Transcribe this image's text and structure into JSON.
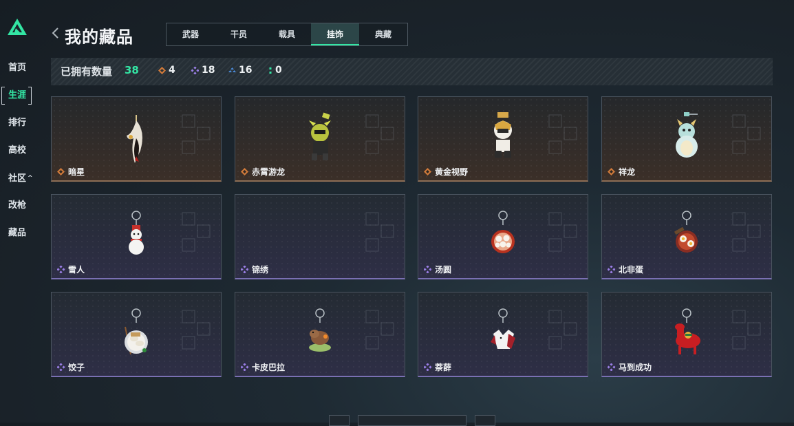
{
  "header": {
    "title": "我的藏品"
  },
  "sidebar": {
    "items": [
      {
        "label": "首页",
        "active": false
      },
      {
        "label": "生涯",
        "active": true
      },
      {
        "label": "排行",
        "active": false
      },
      {
        "label": "高校",
        "active": false
      },
      {
        "label": "社区",
        "active": false,
        "has_caret": true
      },
      {
        "label": "改枪",
        "active": false
      },
      {
        "label": "藏品",
        "active": false
      }
    ],
    "caret": "^"
  },
  "tabs": [
    {
      "label": "武器"
    },
    {
      "label": "干员"
    },
    {
      "label": "载具"
    },
    {
      "label": "挂饰",
      "active": true
    },
    {
      "label": "典藏"
    }
  ],
  "stats": {
    "owned_label": "已拥有数量",
    "owned_count": "38",
    "orange_count": "4",
    "purple_count": "18",
    "blue_count": "16",
    "green_count": "0"
  },
  "colors": {
    "accent": "#33e6a4",
    "orange_rarity": "#d07a3a",
    "purple_rarity": "#9b7fe6",
    "blue_rarity": "#4d8fe0"
  },
  "items": [
    {
      "name": "暗星",
      "rarity": "orange",
      "icon": "dark-star-charm-icon"
    },
    {
      "name": "赤霄游龙",
      "rarity": "orange",
      "icon": "red-dragon-charm-icon"
    },
    {
      "name": "黄金视野",
      "rarity": "orange",
      "icon": "golden-vision-charm-icon"
    },
    {
      "name": "祥龙",
      "rarity": "orange",
      "icon": "auspicious-dragon-charm-icon"
    },
    {
      "name": "雪人",
      "rarity": "purple",
      "icon": "snowman-charm-icon"
    },
    {
      "name": "锦绣",
      "rarity": "purple",
      "icon": "empty-charm-icon"
    },
    {
      "name": "汤圆",
      "rarity": "purple",
      "icon": "tangyuan-charm-icon"
    },
    {
      "name": "北非蛋",
      "rarity": "purple",
      "icon": "shakshuka-charm-icon"
    },
    {
      "name": "饺子",
      "rarity": "purple",
      "icon": "dumpling-charm-icon"
    },
    {
      "name": "卡皮巴拉",
      "rarity": "purple",
      "icon": "capybara-charm-icon"
    },
    {
      "name": "萘薛",
      "rarity": "purple",
      "icon": "naixue-charm-icon"
    },
    {
      "name": "马到成功",
      "rarity": "purple",
      "icon": "horse-charm-icon"
    }
  ]
}
